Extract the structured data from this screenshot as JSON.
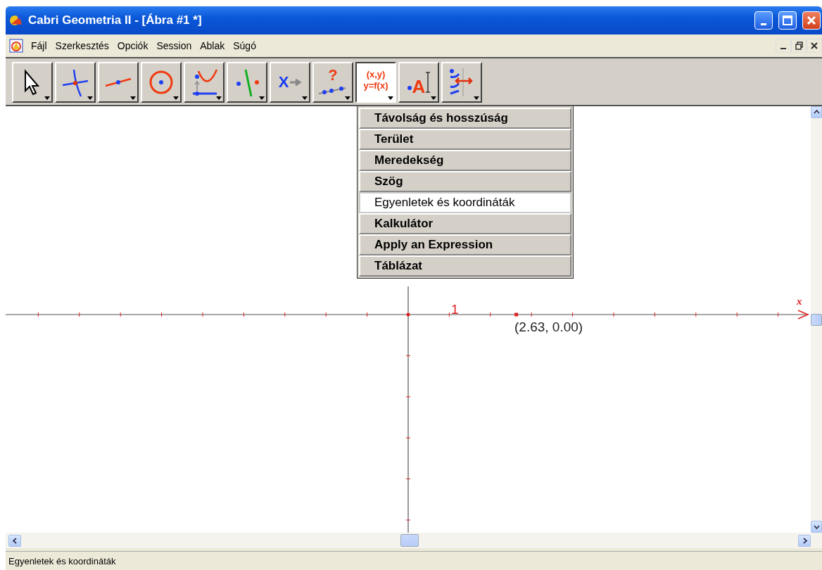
{
  "window": {
    "title": "Cabri Geometria II - [Ábra #1 *]"
  },
  "menu_bar": {
    "items": [
      "Fájl",
      "Szerkesztés",
      "Opciók",
      "Session",
      "Ablak",
      "Súgó"
    ]
  },
  "toolbar": {
    "tools": [
      {
        "kind": "pointer",
        "selected": false
      },
      {
        "kind": "point",
        "selected": false
      },
      {
        "kind": "line",
        "selected": false
      },
      {
        "kind": "circle",
        "selected": false
      },
      {
        "kind": "curve",
        "selected": false
      },
      {
        "kind": "construct",
        "selected": false
      },
      {
        "kind": "transform",
        "glyph": "X",
        "selected": false
      },
      {
        "kind": "property",
        "glyph": "?",
        "selected": false
      },
      {
        "kind": "measure",
        "glyph": "(x,y)",
        "glyph_2": "y=f(x)",
        "selected": true
      },
      {
        "kind": "text",
        "glyph": "A",
        "selected": false
      },
      {
        "kind": "display",
        "selected": false
      }
    ]
  },
  "dropdown_menu": {
    "items": [
      {
        "label": "Távolság és hosszúság",
        "selected": false
      },
      {
        "label": "Terület",
        "selected": false
      },
      {
        "label": "Meredekség",
        "selected": false
      },
      {
        "label": "Szög",
        "selected": false
      },
      {
        "label": "Egyenletek és koordináták",
        "selected": true
      },
      {
        "label": "Kalkulátor",
        "selected": false
      },
      {
        "label": "Apply an Expression",
        "selected": false
      },
      {
        "label": "Táblázat",
        "selected": false
      }
    ]
  },
  "canvas": {
    "unit_label": "1",
    "x_axis_label": "x",
    "point_label": "(2.63, 0.00)"
  },
  "status_bar": {
    "text": "Egyenletek és koordináták"
  }
}
